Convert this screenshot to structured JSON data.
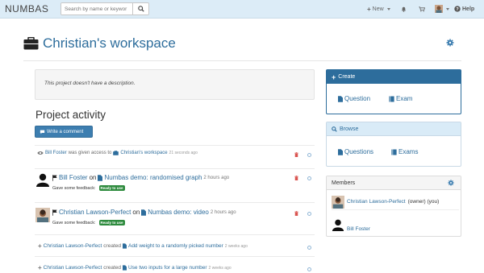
{
  "navbar": {
    "brand": "NUMBAS",
    "search_placeholder": "Search by name or keywor",
    "new_label": "New",
    "help_label": "Help"
  },
  "header": {
    "title": "Christian's workspace"
  },
  "description": {
    "text": "This project doesn't have a description."
  },
  "activity": {
    "title": "Project activity",
    "write_comment_label": "Write a comment",
    "items": [
      {
        "user": "Bill Foster",
        "verb": "was given access to",
        "target": "Christian's workspace",
        "time": "21 seconds ago"
      },
      {
        "user": "Bill Foster",
        "verb": "on",
        "target": "Numbas demo: randomised graph",
        "time": "2 hours ago",
        "comment": "Gave some feedback:",
        "badge": "Ready to use"
      },
      {
        "user": "Christian Lawson-Perfect",
        "verb": "on",
        "target": "Numbas demo: video",
        "time": "2 hours ago",
        "comment": "Gave some feedback:",
        "badge": "Ready to use"
      },
      {
        "user": "Christian Lawson-Perfect",
        "verb": "created",
        "target": "Add weight to a randomly picked number",
        "time": "2 weeks ago"
      },
      {
        "user": "Christian Lawson-Perfect",
        "verb": "created",
        "target": "Use two inputs for a large number",
        "time": "2 weeks ago"
      }
    ]
  },
  "create_panel": {
    "title": "Create",
    "question_label": "Question",
    "exam_label": "Exam"
  },
  "browse_panel": {
    "title": "Browse",
    "questions_label": "Questions",
    "exams_label": "Exams"
  },
  "members_panel": {
    "title": "Members",
    "members": [
      {
        "name": "Christian Lawson-Perfect",
        "role": "(owner) (you)"
      },
      {
        "name": "Bill Foster",
        "role": ""
      }
    ]
  },
  "colors": {
    "navbar": "#dcecf7",
    "link": "#2d6d9c",
    "primary": "#3d7eb0",
    "success": "#2e8b3e",
    "danger": "#d9534f"
  }
}
